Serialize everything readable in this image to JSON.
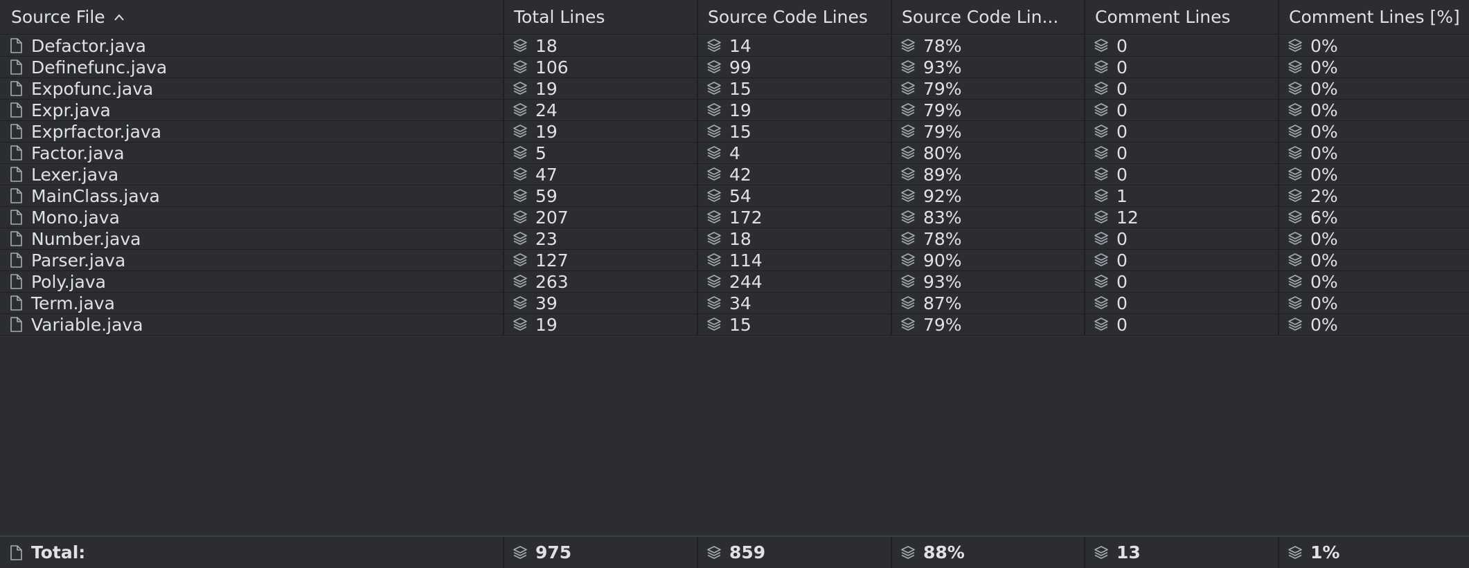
{
  "columns": [
    "Source File",
    "Total Lines",
    "Source Code Lines",
    "Source Code Lin...",
    "Comment Lines",
    "Comment Lines [%]"
  ],
  "rows": [
    [
      "Defactor.java",
      "18",
      "14",
      "78%",
      "0",
      "0%"
    ],
    [
      "Definefunc.java",
      "106",
      "99",
      "93%",
      "0",
      "0%"
    ],
    [
      "Expofunc.java",
      "19",
      "15",
      "79%",
      "0",
      "0%"
    ],
    [
      "Expr.java",
      "24",
      "19",
      "79%",
      "0",
      "0%"
    ],
    [
      "Exprfactor.java",
      "19",
      "15",
      "79%",
      "0",
      "0%"
    ],
    [
      "Factor.java",
      "5",
      "4",
      "80%",
      "0",
      "0%"
    ],
    [
      "Lexer.java",
      "47",
      "42",
      "89%",
      "0",
      "0%"
    ],
    [
      "MainClass.java",
      "59",
      "54",
      "92%",
      "1",
      "2%"
    ],
    [
      "Mono.java",
      "207",
      "172",
      "83%",
      "12",
      "6%"
    ],
    [
      "Number.java",
      "23",
      "18",
      "78%",
      "0",
      "0%"
    ],
    [
      "Parser.java",
      "127",
      "114",
      "90%",
      "0",
      "0%"
    ],
    [
      "Poly.java",
      "263",
      "244",
      "93%",
      "0",
      "0%"
    ],
    [
      "Term.java",
      "39",
      "34",
      "87%",
      "0",
      "0%"
    ],
    [
      "Variable.java",
      "19",
      "15",
      "79%",
      "0",
      "0%"
    ]
  ],
  "total": [
    "Total:",
    "975",
    "859",
    "88%",
    "13",
    "1%"
  ],
  "icons": {
    "file": "file-icon",
    "metric": "layers-icon",
    "sort": "chevron-up-icon"
  },
  "colors": {
    "background": "#2b2d30",
    "text": "#dfe1e5",
    "grid": "#1e1f22",
    "icon": "#a8adb5"
  }
}
